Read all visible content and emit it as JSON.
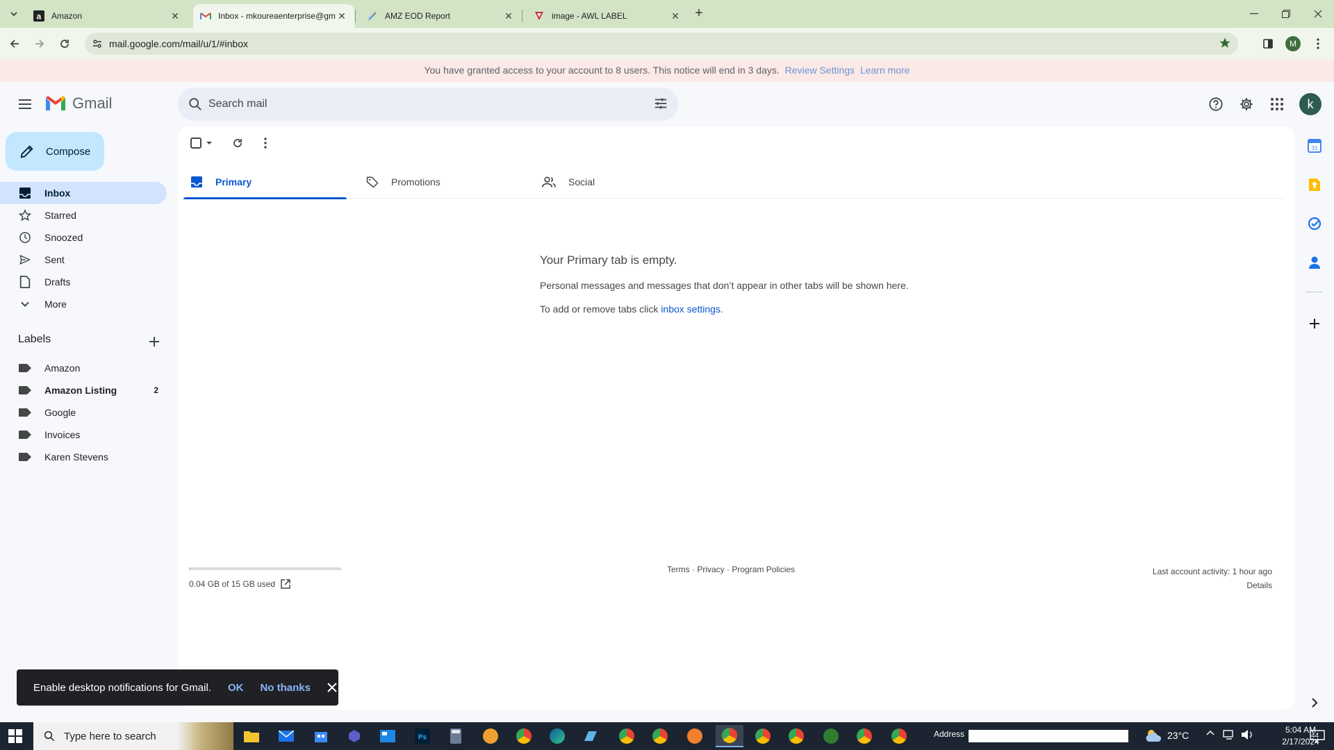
{
  "browser": {
    "tabs": [
      {
        "title": "Amazon",
        "favicon": "amazon-icon",
        "active": false
      },
      {
        "title": "Inbox - mkoureaenterprise@gm",
        "favicon": "gmail-icon",
        "active": true
      },
      {
        "title": "AMZ EOD Report",
        "favicon": "pencil-icon",
        "active": false
      },
      {
        "title": "image - AWL LABEL",
        "favicon": "vivaldi-icon",
        "active": false
      }
    ],
    "url": "mail.google.com/mail/u/1/#inbox",
    "profile_initial": "M",
    "notice": {
      "text": "You have granted access to your account to 8 users. This notice will end in 3 days.",
      "link1": "Review Settings",
      "link2": "Learn more"
    }
  },
  "gmail": {
    "brand": "Gmail",
    "search_placeholder": "Search mail",
    "avatar_initial": "k",
    "compose_label": "Compose",
    "nav": [
      {
        "label": "Inbox",
        "icon": "inbox-icon",
        "active": true
      },
      {
        "label": "Starred",
        "icon": "star-icon",
        "active": false
      },
      {
        "label": "Snoozed",
        "icon": "clock-icon",
        "active": false
      },
      {
        "label": "Sent",
        "icon": "send-icon",
        "active": false
      },
      {
        "label": "Drafts",
        "icon": "draft-icon",
        "active": false
      },
      {
        "label": "More",
        "icon": "chevron-down-icon",
        "active": false
      }
    ],
    "labels_title": "Labels",
    "labels": [
      {
        "label": "Amazon",
        "count": "",
        "bold": false
      },
      {
        "label": "Amazon Listing",
        "count": "2",
        "bold": true
      },
      {
        "label": "Google",
        "count": "",
        "bold": false
      },
      {
        "label": "Invoices",
        "count": "",
        "bold": false
      },
      {
        "label": "Karen Stevens",
        "count": "",
        "bold": false
      }
    ],
    "inbox_tabs": [
      {
        "label": "Primary",
        "icon": "inbox-icon",
        "active": true
      },
      {
        "label": "Promotions",
        "icon": "tag-icon",
        "active": false
      },
      {
        "label": "Social",
        "icon": "people-icon",
        "active": false
      }
    ],
    "empty": {
      "title": "Your Primary tab is empty.",
      "message": "Personal messages and messages that don’t appear in other tabs will be shown here.",
      "settings_prefix": "To add or remove tabs click ",
      "settings_link": "inbox settings",
      "settings_suffix": "."
    },
    "storage": {
      "text": "0.04 GB of 15 GB used",
      "used_fraction": 0.003
    },
    "footer": {
      "terms": "Terms",
      "privacy": "Privacy",
      "policies": "Program Policies",
      "sep": " · "
    },
    "activity": {
      "text": "Last account activity: 1 hour ago",
      "details": "Details"
    },
    "snackbar": {
      "message": "Enable desktop notifications for Gmail.",
      "ok": "OK",
      "no": "No thanks"
    }
  },
  "taskbar": {
    "search_placeholder": "Type here to search",
    "address_label": "Address",
    "temperature": "23°C",
    "time": "5:04 AM",
    "date": "2/17/2024",
    "notification_count": "44"
  }
}
